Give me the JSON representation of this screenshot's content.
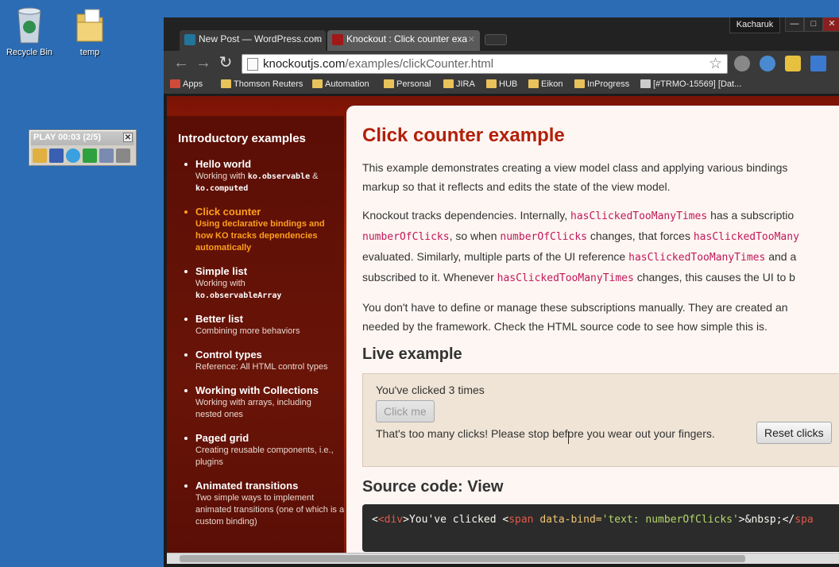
{
  "desktop": {
    "icons": [
      {
        "label": "Recycle Bin",
        "icon": "recycle-bin-icon"
      },
      {
        "label": "temp",
        "icon": "folder-icon"
      }
    ],
    "play_widget": {
      "title": "PLAY 00:03 (2/5)",
      "close": "✕"
    }
  },
  "browser": {
    "tabs": [
      {
        "label": "New Post — WordPress.com",
        "icon": "wordpress-icon",
        "active": false
      },
      {
        "label": "Knockout : Click counter exa",
        "icon": "knockout-icon",
        "active": true
      }
    ],
    "user": "Kacharuk",
    "address": {
      "host": "knockoutjs.com",
      "path": "/examples/clickCounter.html"
    },
    "bookmarks": [
      "Apps",
      "Thomson Reuters",
      "Automation",
      "Personal",
      "JIRA",
      "HUB",
      "Eikon",
      "InProgress",
      "[#TRMO-15569] [Dat..."
    ]
  },
  "sidebar": {
    "heading": "Introductory examples",
    "items": [
      {
        "name": "Hello world",
        "desc_pre": "Working with ",
        "code1": "ko.observable",
        "desc_mid": " & ",
        "code2": "ko.computed",
        "active": false
      },
      {
        "name": "Click counter",
        "desc": "Using declarative bindings and how KO tracks dependencies automatically",
        "active": true
      },
      {
        "name": "Simple list",
        "desc_pre": "Working with ",
        "code1": "ko.observableArray",
        "active": false
      },
      {
        "name": "Better list",
        "desc": "Combining more behaviors",
        "active": false
      },
      {
        "name": "Control types",
        "desc": "Reference: All HTML control types",
        "active": false
      },
      {
        "name": "Working with Collections",
        "desc": "Working with arrays, including nested ones",
        "active": false
      },
      {
        "name": "Paged grid",
        "desc": "Creating reusable components, i.e., plugins",
        "active": false
      },
      {
        "name": "Animated transitions",
        "desc": "Two simple ways to implement animated transitions (one of which is a custom binding)",
        "active": false
      }
    ]
  },
  "main": {
    "title": "Click counter example",
    "p1_line1": "This example demonstrates creating a view model class and applying various bindings",
    "p1_line2": "markup so that it reflects and edits the state of the view model.",
    "p2": {
      "l1a": "Knockout tracks dependencies. Internally, ",
      "l1code": "hasClickedTooManyTimes",
      "l1b": " has a subscriptio",
      "l2code1": "numberOfClicks",
      "l2a": ", so when ",
      "l2code2": "numberOfClicks",
      "l2b": " changes, that forces ",
      "l2code3": "hasClickedTooMany",
      "l3a": "evaluated. Similarly, multiple parts of the UI reference ",
      "l3code": "hasClickedTooManyTimes",
      "l3b": " and a",
      "l4a": "subscribed to it. Whenever ",
      "l4code": "hasClickedTooManyTimes",
      "l4b": " changes, this causes the UI to b"
    },
    "p3_line1": "You don't have to define or manage these subscriptions manually. They are created an",
    "p3_line2": "needed by the framework. Check the HTML source code to see how simple this is.",
    "live_heading": "Live example",
    "clicked_text": "You've clicked 3 times",
    "click_button": "Click me",
    "too_many_text": "That's too many clicks! Please stop before you wear out your fingers.",
    "reset_button": "Reset clicks",
    "source_heading": "Source code: View",
    "source": {
      "t1": "<div",
      "t2": ">You've clicked <",
      "t3": "span",
      "t4": " data-bind=",
      "t5": "'text: numberOfClicks'",
      "t6": ">&nbsp;</",
      "t7": "spa"
    }
  }
}
